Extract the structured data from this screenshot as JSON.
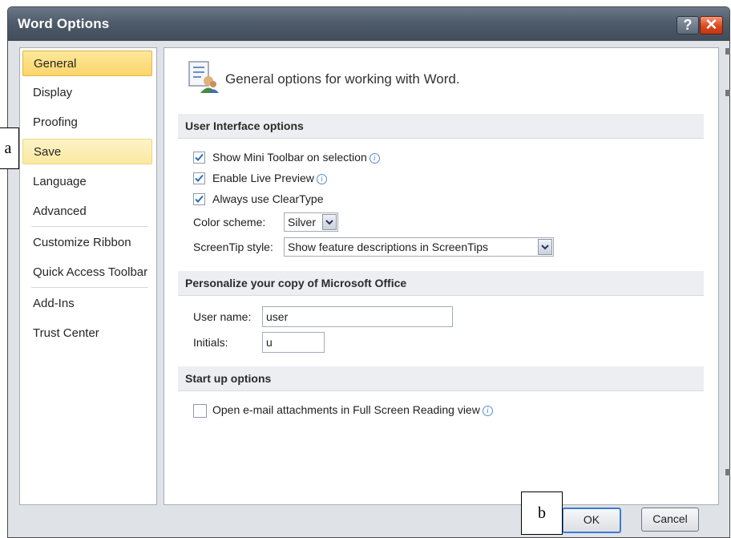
{
  "window": {
    "title": "Word Options",
    "help_label": "?",
    "close_label": "✕"
  },
  "nav": {
    "items": [
      {
        "label": "General"
      },
      {
        "label": "Display"
      },
      {
        "label": "Proofing"
      },
      {
        "label": "Save"
      },
      {
        "label": "Language"
      },
      {
        "label": "Advanced"
      },
      {
        "label": "Customize Ribbon"
      },
      {
        "label": "Quick Access Toolbar"
      },
      {
        "label": "Add-Ins"
      },
      {
        "label": "Trust Center"
      }
    ]
  },
  "main": {
    "header": {
      "text": "General options for working with Word.",
      "icon": "general-options-icon"
    },
    "ui_section": {
      "title": "User Interface options",
      "options": [
        {
          "label": "Show Mini Toolbar on selection",
          "checked": true,
          "info": true
        },
        {
          "label": "Enable Live Preview",
          "checked": true,
          "info": true
        },
        {
          "label": "Always use ClearType",
          "checked": true,
          "info": false
        }
      ],
      "color_scheme_label": "Color scheme:",
      "color_scheme_value": "Silver",
      "screentip_label": "ScreenTip style:",
      "screentip_value": "Show feature descriptions in ScreenTips"
    },
    "personalize_section": {
      "title": "Personalize your copy of Microsoft Office",
      "username_label": "User name:",
      "username_value": "user",
      "initials_label": "Initials:",
      "initials_value": "u"
    },
    "startup_section": {
      "title": "Start up options",
      "option_label": "Open e-mail attachments in Full Screen Reading view",
      "option_checked": false
    }
  },
  "footer": {
    "ok_label": "OK",
    "cancel_label": "Cancel"
  },
  "callouts": {
    "a": "a",
    "b": "b"
  },
  "colors": {
    "titlebar": "#4f5c6b",
    "selected_nav": "#fbd56b",
    "close_button": "#d9481e",
    "check": "#2e6bb5"
  }
}
